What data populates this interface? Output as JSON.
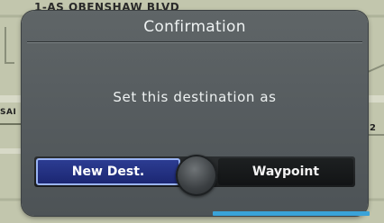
{
  "map": {
    "street_name": "1-AS OBENSHAW BLVD",
    "street_label_left": "SAI",
    "street_label_right": "2"
  },
  "dialog": {
    "title": "Confirmation",
    "message": "Set this destination as",
    "buttons": {
      "new_dest": "New Dest.",
      "waypoint": "Waypoint"
    },
    "selected_button": "new_dest"
  },
  "colors": {
    "dialog_bg": "#5a6063",
    "selected_button": "#24318a",
    "selected_border": "#9ab4f4",
    "map_bg": "#c2c6ad"
  },
  "icons": {
    "knob": "joystick-knob-icon"
  }
}
